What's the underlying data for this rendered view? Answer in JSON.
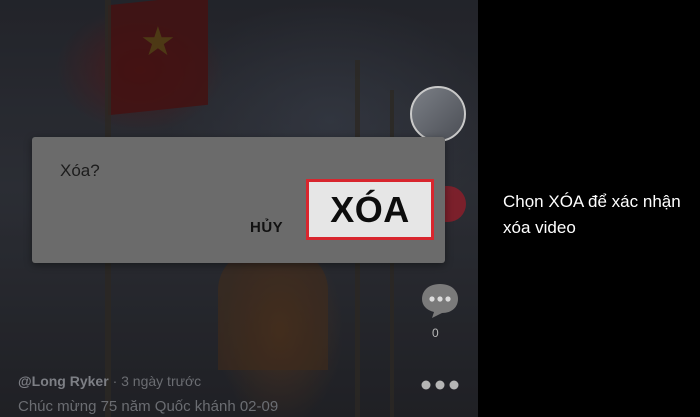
{
  "dialog": {
    "title": "Xóa?",
    "cancel_label": "HỦY",
    "delete_label": "XÓA"
  },
  "video": {
    "author": "@Long Ryker",
    "time": "3 ngày trước",
    "caption": "Chúc mừng 75 năm Quốc khánh 02-09",
    "comment_count": "0"
  },
  "instruction": "Chọn XÓA để xác nhận xóa video",
  "colors": {
    "highlight_border": "#d8262e",
    "dialog_bg": "#6b6b6b",
    "page_bg": "#000000"
  },
  "icons": [
    "comment-icon",
    "heart-icon",
    "more-icon",
    "avatar"
  ]
}
